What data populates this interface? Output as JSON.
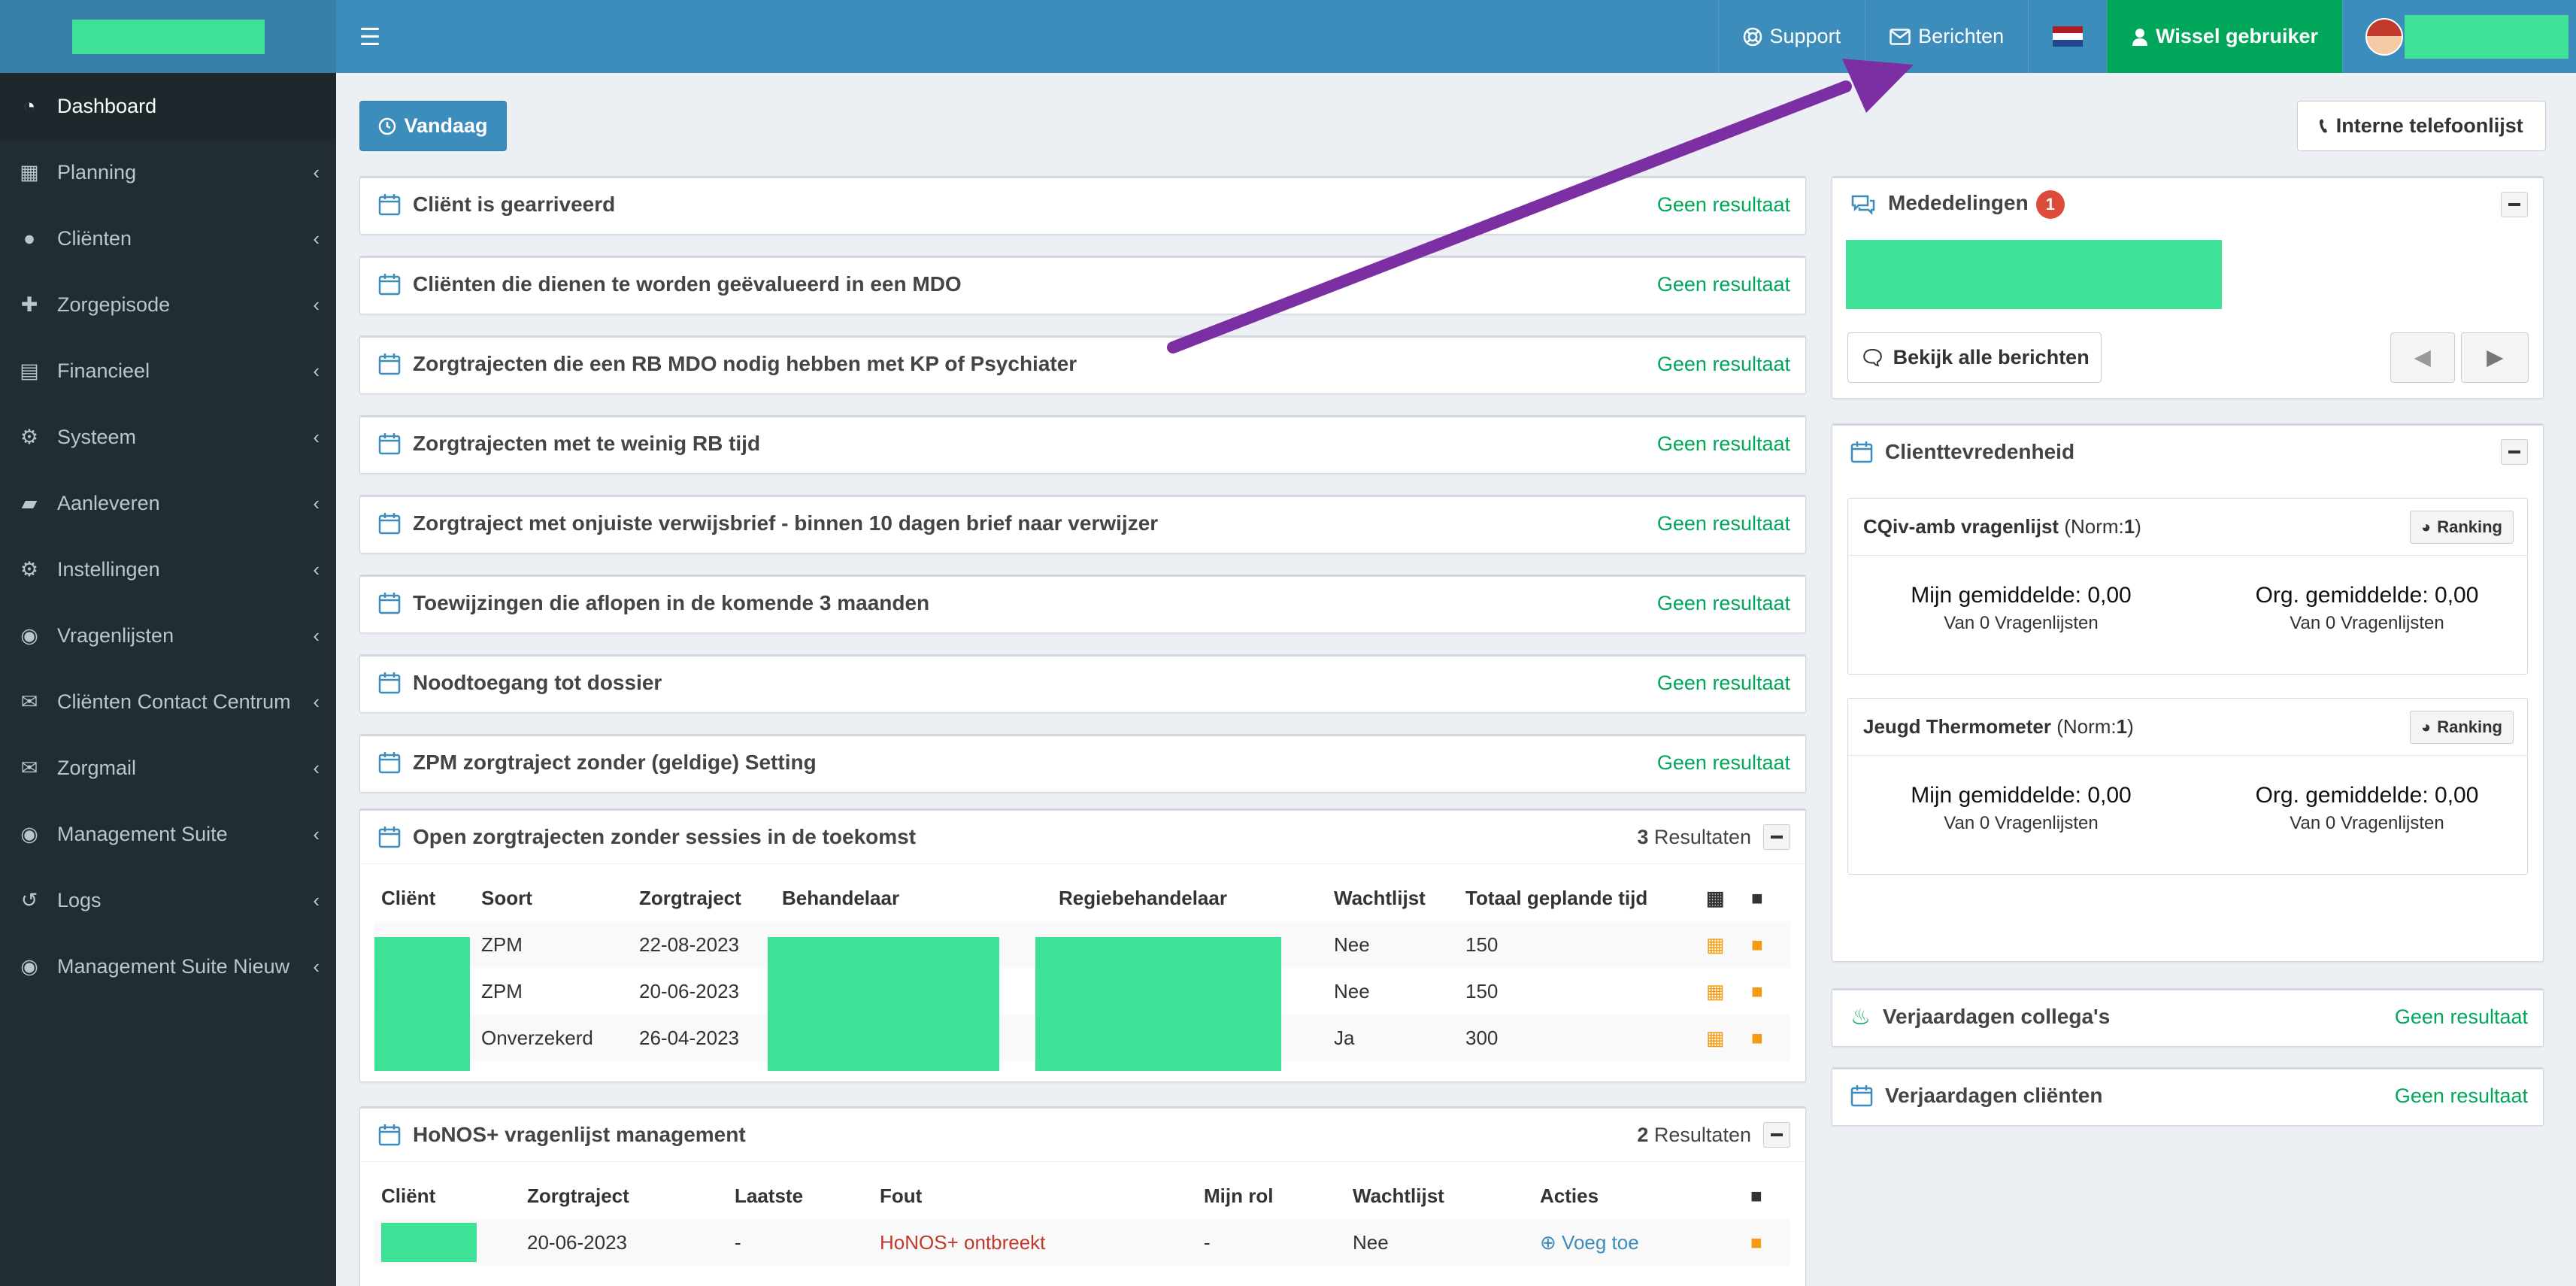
{
  "sidebar": {
    "items": [
      {
        "label": "Dashboard",
        "icon": "dashboard-icon",
        "active": true
      },
      {
        "label": "Planning",
        "icon": "calendar-icon"
      },
      {
        "label": "Cliënten",
        "icon": "user-icon"
      },
      {
        "label": "Zorgepisode",
        "icon": "medkit-icon"
      },
      {
        "label": "Financieel",
        "icon": "book-icon"
      },
      {
        "label": "Systeem",
        "icon": "cogs-icon"
      },
      {
        "label": "Aanleveren",
        "icon": "truck-icon"
      },
      {
        "label": "Instellingen",
        "icon": "gear-icon"
      },
      {
        "label": "Vragenlijsten",
        "icon": "globe-icon"
      },
      {
        "label": "Cliënten Contact Centrum",
        "icon": "envelope-icon"
      },
      {
        "label": "Zorgmail",
        "icon": "envelope-icon"
      },
      {
        "label": "Management Suite",
        "icon": "globe-icon"
      },
      {
        "label": "Logs",
        "icon": "history-icon"
      },
      {
        "label": "Management Suite Nieuw",
        "icon": "globe-icon"
      }
    ]
  },
  "topbar": {
    "support": "Support",
    "messages": "Berichten",
    "switch_user": "Wissel gebruiker"
  },
  "toolbar": {
    "today": "Vandaag",
    "phonebook": "Interne telefoonlijst"
  },
  "no_result": "Geen resultaat",
  "panels": [
    {
      "title": "Cliënt is gearriveerd"
    },
    {
      "title": "Cliënten die dienen te worden geëvalueerd in een MDO"
    },
    {
      "title": "Zorgtrajecten die een RB MDO nodig hebben met KP of Psychiater"
    },
    {
      "title": "Zorgtrajecten met te weinig RB tijd"
    },
    {
      "title": "Zorgtraject met onjuiste verwijsbrief - binnen 10 dagen brief naar verwijzer"
    },
    {
      "title": "Toewijzingen die aflopen in de komende 3 maanden"
    },
    {
      "title": "Noodtoegang tot dossier"
    },
    {
      "title": "ZPM zorgtraject zonder (geldige) Setting"
    }
  ],
  "open_trajects": {
    "title": "Open zorgtrajecten zonder sessies in de toekomst",
    "count": "3",
    "count_label": "Resultaten",
    "headers": [
      "Cliënt",
      "Soort",
      "Zorgtraject",
      "Behandelaar",
      "Regiebehandelaar",
      "Wachtlijst",
      "Totaal geplande tijd"
    ],
    "rows": [
      {
        "soort": "ZPM",
        "date": "22-08-2023",
        "wachtlijst": "Nee",
        "tijd": "150"
      },
      {
        "soort": "ZPM",
        "date": "20-06-2023",
        "wachtlijst": "Nee",
        "tijd": "150"
      },
      {
        "soort": "Onverzekerd",
        "date": "26-04-2023",
        "wachtlijst": "Ja",
        "tijd": "300"
      }
    ]
  },
  "honos": {
    "title": "HoNOS+ vragenlijst management",
    "count": "2",
    "count_label": "Resultaten",
    "headers": [
      "Cliënt",
      "Zorgtraject",
      "Laatste",
      "Fout",
      "Mijn rol",
      "Wachtlijst",
      "Acties"
    ],
    "row": {
      "date": "20-06-2023",
      "laatste": "-",
      "fout": "HoNOS+ ontbreekt",
      "rol": "-",
      "wachtlijst": "Nee",
      "actie": "Voeg toe"
    }
  },
  "announcements": {
    "title": "Mededelingen",
    "badge": "1",
    "view_all": "Bekijk alle berichten"
  },
  "satisfaction": {
    "title": "Clienttevredenheid",
    "ranking": "Ranking",
    "surveys": [
      {
        "name": "CQiv-amb vragenlijst",
        "norm_prefix": "(Norm: ",
        "norm": "1",
        "norm_suffix": ")",
        "mine": "Mijn gemiddelde: 0,00",
        "mine_sub": "Van 0 Vragenlijsten",
        "org": "Org. gemiddelde: 0,00",
        "org_sub": "Van 0 Vragenlijsten"
      },
      {
        "name": "Jeugd Thermometer",
        "norm_prefix": "(Norm: ",
        "norm": "1",
        "norm_suffix": ")",
        "mine": "Mijn gemiddelde: 0,00",
        "mine_sub": "Van 0 Vragenlijsten",
        "org": "Org. gemiddelde: 0,00",
        "org_sub": "Van 0 Vragenlijsten"
      }
    ]
  },
  "birthdays_colleagues": {
    "title": "Verjaardagen collega's"
  },
  "birthdays_clients": {
    "title": "Verjaardagen cliënten"
  },
  "colors": {
    "primary": "#3c8dbc",
    "success": "#00a65a",
    "sidebar": "#222d32",
    "redaction": "#3ee196",
    "annotation_arrow": "#7b2fa3"
  }
}
